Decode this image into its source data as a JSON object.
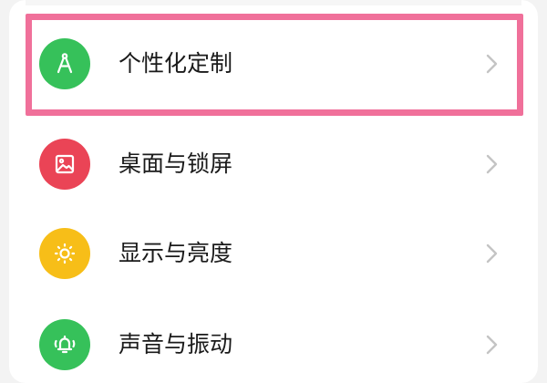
{
  "settings": {
    "items": [
      {
        "label": "个性化定制",
        "icon": "compass-icon",
        "color": "#36c15a"
      },
      {
        "label": "桌面与锁屏",
        "icon": "picture-icon",
        "color": "#ea4456"
      },
      {
        "label": "显示与亮度",
        "icon": "sun-icon",
        "color": "#f7be18"
      },
      {
        "label": "声音与振动",
        "icon": "bell-vibrate-icon",
        "color": "#36c15a"
      }
    ],
    "highlight_color": "#f0709a"
  }
}
